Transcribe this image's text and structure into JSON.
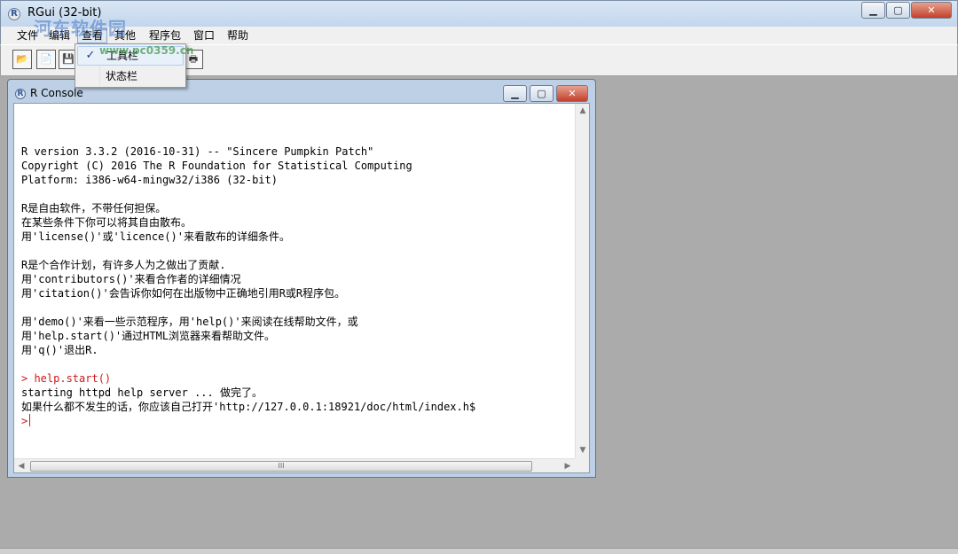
{
  "window": {
    "title": "RGui (32-bit)",
    "app_icon": "R"
  },
  "caption_buttons": {
    "minimize": "▁",
    "maximize": "▢",
    "close": "✕"
  },
  "menubar": {
    "items": [
      {
        "label": "文件"
      },
      {
        "label": "编辑"
      },
      {
        "label": "查看",
        "active": true
      },
      {
        "label": "其他"
      },
      {
        "label": "程序包"
      },
      {
        "label": "窗口"
      },
      {
        "label": "帮助"
      }
    ]
  },
  "toolbar": {
    "buttons": [
      {
        "icon": "open-script-icon",
        "glyph": "📂"
      },
      {
        "icon": "load-workspace-icon",
        "glyph": "📄"
      },
      {
        "icon": "save-workspace-icon",
        "glyph": "💾"
      },
      {
        "icon": "print-icon",
        "glyph": "🖶"
      }
    ]
  },
  "view_menu": {
    "items": [
      {
        "label": "工具栏",
        "checked": true,
        "check": "✓"
      },
      {
        "label": "状态栏",
        "checked": false
      }
    ]
  },
  "console": {
    "title": "R Console",
    "icon": "R",
    "lines": [
      {
        "text": "",
        "kind": "out"
      },
      {
        "text": "R version 3.3.2 (2016-10-31) -- \"Sincere Pumpkin Patch\"",
        "kind": "out"
      },
      {
        "text": "Copyright (C) 2016 The R Foundation for Statistical Computing",
        "kind": "out"
      },
      {
        "text": "Platform: i386-w64-mingw32/i386 (32-bit)",
        "kind": "out"
      },
      {
        "text": "",
        "kind": "out"
      },
      {
        "text": "R是自由软件，不带任何担保。",
        "kind": "out"
      },
      {
        "text": "在某些条件下你可以将其自由散布。",
        "kind": "out"
      },
      {
        "text": "用'license()'或'licence()'来看散布的详细条件。",
        "kind": "out"
      },
      {
        "text": "",
        "kind": "out"
      },
      {
        "text": "R是个合作计划，有许多人为之做出了贡献.",
        "kind": "out"
      },
      {
        "text": "用'contributors()'来看合作者的详细情况",
        "kind": "out"
      },
      {
        "text": "用'citation()'会告诉你如何在出版物中正确地引用R或R程序包。",
        "kind": "out"
      },
      {
        "text": "",
        "kind": "out"
      },
      {
        "text": "用'demo()'来看一些示范程序，用'help()'来阅读在线帮助文件，或",
        "kind": "out"
      },
      {
        "text": "用'help.start()'通过HTML浏览器来看帮助文件。",
        "kind": "out"
      },
      {
        "text": "用'q()'退出R.",
        "kind": "out"
      },
      {
        "text": "",
        "kind": "out"
      },
      {
        "text": "> help.start()",
        "kind": "cmd"
      },
      {
        "text": "starting httpd help server ... 做完了。",
        "kind": "out"
      },
      {
        "text": "如果什么都不发生的话，你应该自己打开'http://127.0.0.1:18921/doc/html/index.h$",
        "kind": "out"
      }
    ],
    "prompt": ">"
  },
  "scrollbar": {
    "up": "▲",
    "down": "▼",
    "left": "◀",
    "right": "▶",
    "grip": "III"
  },
  "watermark": {
    "text": "河东软件园",
    "url": "www.pc0359.cn"
  },
  "colors": {
    "command": "#cc1a1a",
    "mdi_background": "#ababab",
    "title_gradient": "#c2d6ec"
  }
}
